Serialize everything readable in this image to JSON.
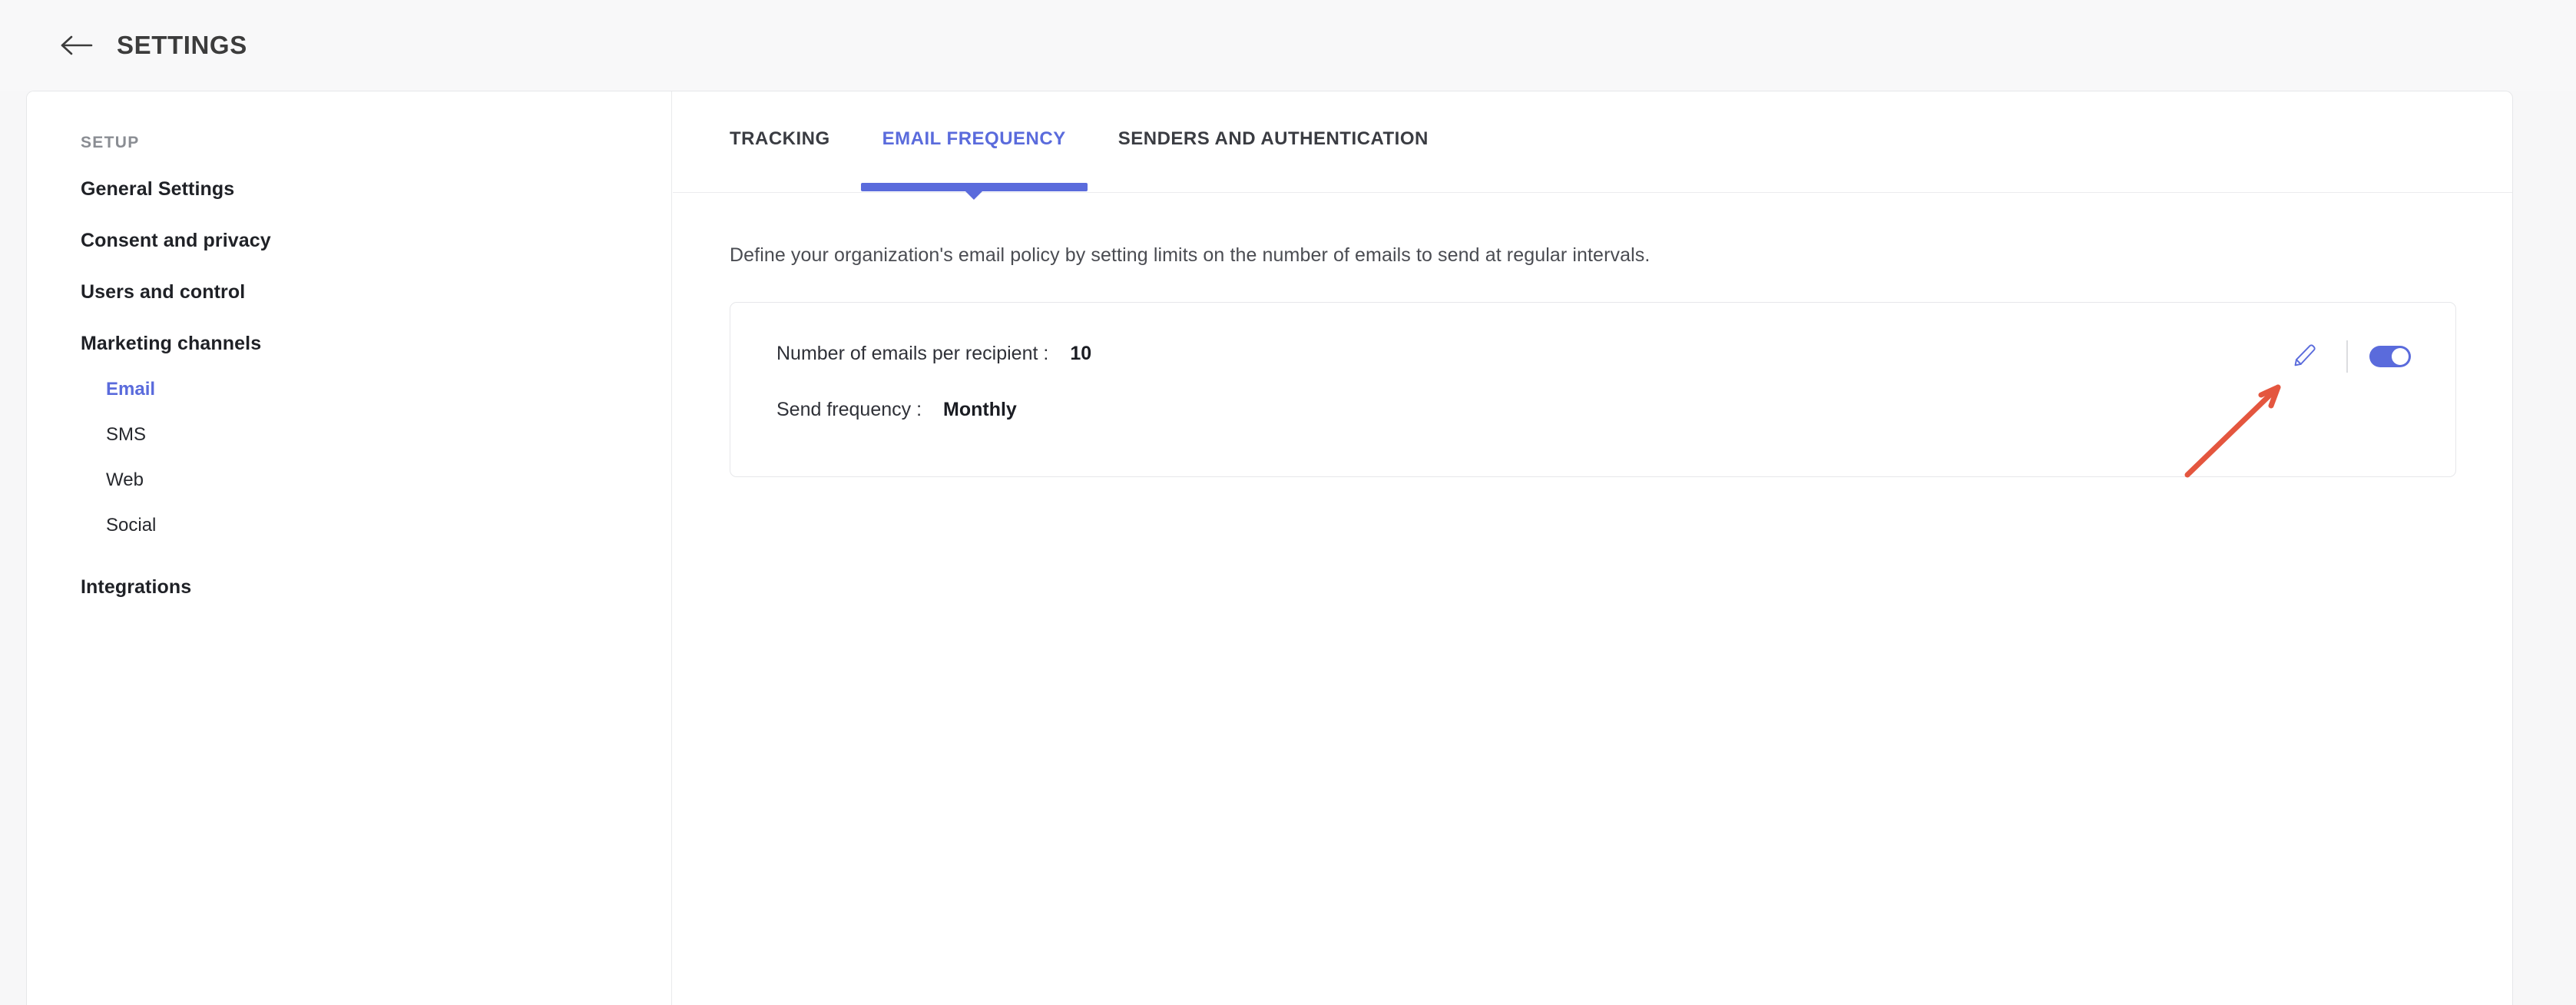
{
  "header": {
    "title": "SETTINGS",
    "back_icon": "arrow-left-icon"
  },
  "sidebar": {
    "section_label": "SETUP",
    "items": [
      {
        "label": "General Settings",
        "type": "top",
        "active": false
      },
      {
        "label": "Consent and privacy",
        "type": "top",
        "active": false
      },
      {
        "label": "Users and control",
        "type": "top",
        "active": false
      },
      {
        "label": "Marketing channels",
        "type": "top",
        "active": false
      }
    ],
    "sub_items": [
      {
        "label": "Email",
        "active": true
      },
      {
        "label": "SMS",
        "active": false
      },
      {
        "label": "Web",
        "active": false
      },
      {
        "label": "Social",
        "active": false
      }
    ],
    "footer_items": [
      {
        "label": "Integrations",
        "type": "top",
        "active": false
      }
    ]
  },
  "content": {
    "tabs": [
      {
        "label": "TRACKING",
        "active": false
      },
      {
        "label": "EMAIL FREQUENCY",
        "active": true
      },
      {
        "label": "SENDERS AND AUTHENTICATION",
        "active": false
      }
    ],
    "description": "Define your organization's email policy by setting limits on the number of emails to send at regular intervals.",
    "policy_card": {
      "rows": [
        {
          "label": "Number of emails per recipient :",
          "value": "10"
        },
        {
          "label": "Send frequency :",
          "value": "Monthly"
        }
      ],
      "edit_icon": "pencil-edit-icon",
      "toggle_state": "on"
    }
  },
  "annotation": {
    "arrow_icon": "red-pointer-arrow",
    "color": "#e4563f"
  },
  "colors": {
    "accent": "#5a6bdc",
    "page_background": "#f7f7f8",
    "panel_background": "#ffffff",
    "border": "#e6e7ea",
    "text_primary": "#1f2126",
    "text_muted": "#8a8d93"
  }
}
